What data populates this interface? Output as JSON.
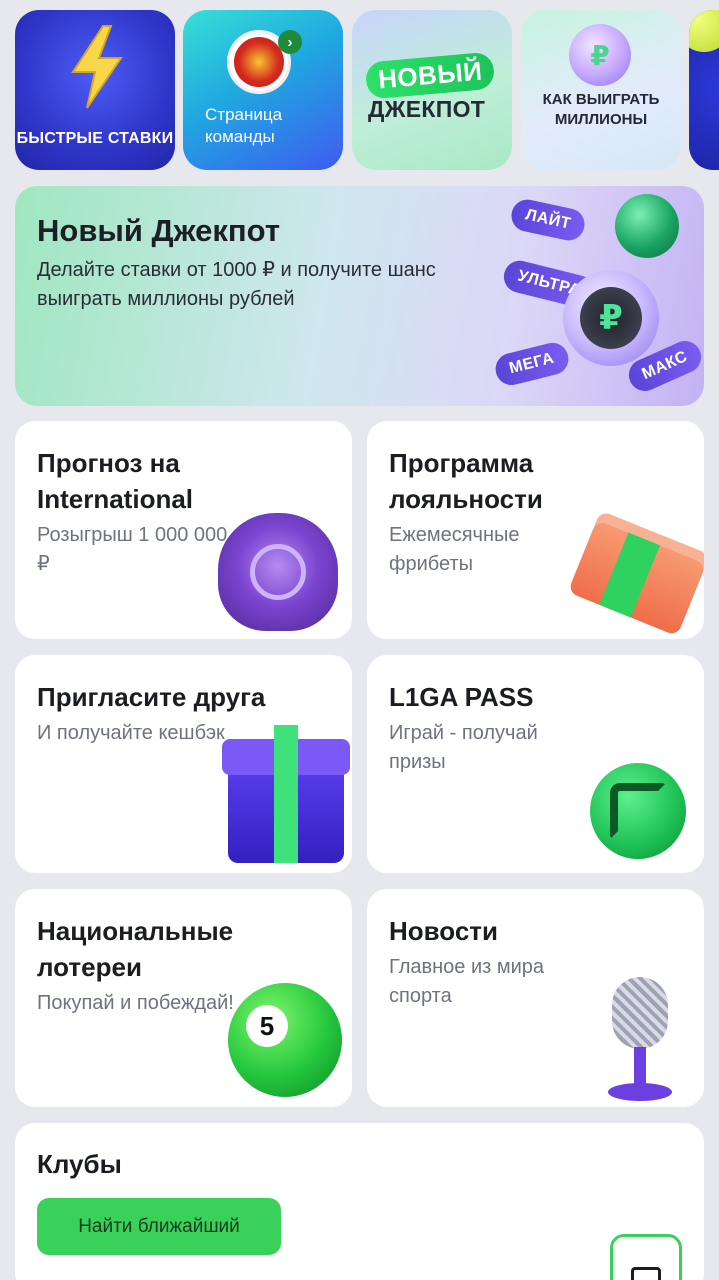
{
  "stories": [
    {
      "label": "БЫСТРЫЕ СТАВКИ",
      "icon": "lightning-icon"
    },
    {
      "label": "Страница команды",
      "icon": "team-crest-icon",
      "badge": "›"
    },
    {
      "pill": "НОВЫЙ",
      "word": "ДЖЕКПОТ"
    },
    {
      "label": "КАК ВЫИГРАТЬ МИЛЛИОНЫ",
      "icon": "coin-icon",
      "coin_symbol": "₽"
    },
    {
      "icon": "tennis-ball-icon"
    }
  ],
  "banner": {
    "title": "Новый Джекпот",
    "subtitle": "Делайте ставки от 1000 ₽ и получите шанс выиграть миллионы рублей",
    "tags": [
      "ЛАЙТ",
      "УЛЬТРА",
      "МЕГА",
      "МАКС"
    ],
    "coin_symbol": "₽"
  },
  "cards": [
    {
      "title": "Прогноз на International",
      "subtitle": "Розыгрыш 1 000 000 ₽"
    },
    {
      "title": "Программа лояльности",
      "subtitle": "Ежемесячные фрибеты"
    },
    {
      "title": "Пригласите друга",
      "subtitle": "И получайте кешбэк"
    },
    {
      "title": "L1GA PASS",
      "subtitle": "Играй - получай призы"
    },
    {
      "title": "Национальные лотереи",
      "subtitle": "Покупай и побеждай!",
      "ball_number": "5"
    },
    {
      "title": "Новости",
      "subtitle": "Главное из мира спорта"
    }
  ],
  "clubs": {
    "title": "Клубы",
    "button": "Найти ближайший"
  },
  "colors": {
    "accent": "#3ad15a",
    "background": "#e6e8ee",
    "story_blue": "#2f35c9",
    "purple": "#6b3fe0"
  }
}
